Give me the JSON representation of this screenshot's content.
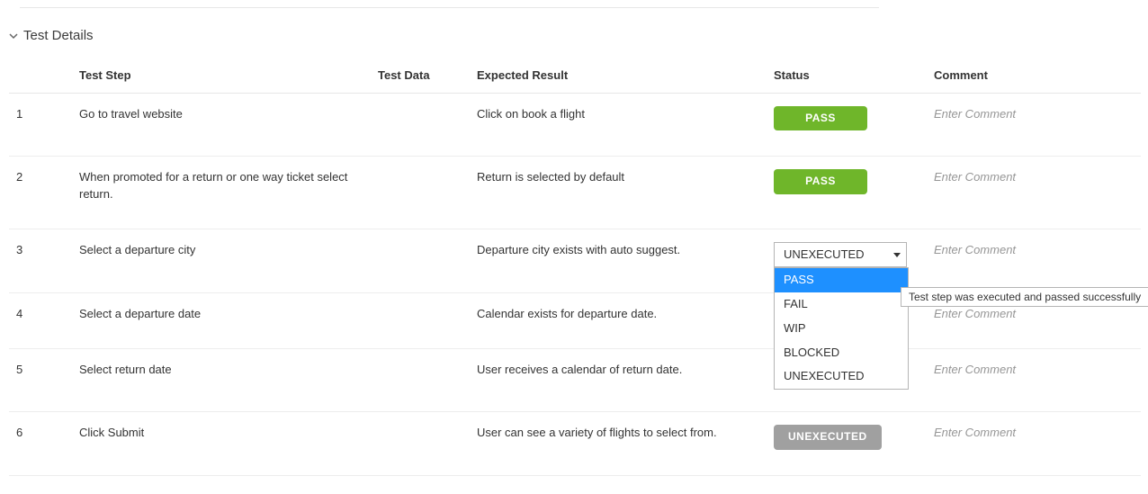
{
  "section": {
    "title": "Test Details"
  },
  "columns": {
    "step": "Test Step",
    "data": "Test Data",
    "result": "Expected Result",
    "status": "Status",
    "comment": "Comment"
  },
  "comment_placeholder": "Enter Comment",
  "badges": {
    "pass": "PASS",
    "unexecuted": "UNEXECUTED"
  },
  "status_select": {
    "value": "UNEXECUTED",
    "options": [
      "PASS",
      "FAIL",
      "WIP",
      "BLOCKED",
      "UNEXECUTED"
    ],
    "highlighted": "PASS"
  },
  "tooltip": "Test step was executed and passed successfully",
  "rows": [
    {
      "num": "1",
      "step": "Go to travel website",
      "data": "",
      "result": "Click on book a flight",
      "status": "pass"
    },
    {
      "num": "2",
      "step": "When promoted for a return or one way ticket select return.",
      "data": "",
      "result": "Return is selected by default",
      "status": "pass"
    },
    {
      "num": "3",
      "step": "Select a departure city",
      "data": "",
      "result": "Departure city exists with auto suggest.",
      "status": "select-open"
    },
    {
      "num": "4",
      "step": "Select a departure date",
      "data": "",
      "result": "Calendar exists for departure date.",
      "status": "none"
    },
    {
      "num": "5",
      "step": "Select return date",
      "data": "",
      "result": "User receives a calendar of return date.",
      "status": "unexecuted"
    },
    {
      "num": "6",
      "step": "Click Submit",
      "data": "",
      "result": "User can see a variety of flights to select from.",
      "status": "unexecuted"
    }
  ]
}
